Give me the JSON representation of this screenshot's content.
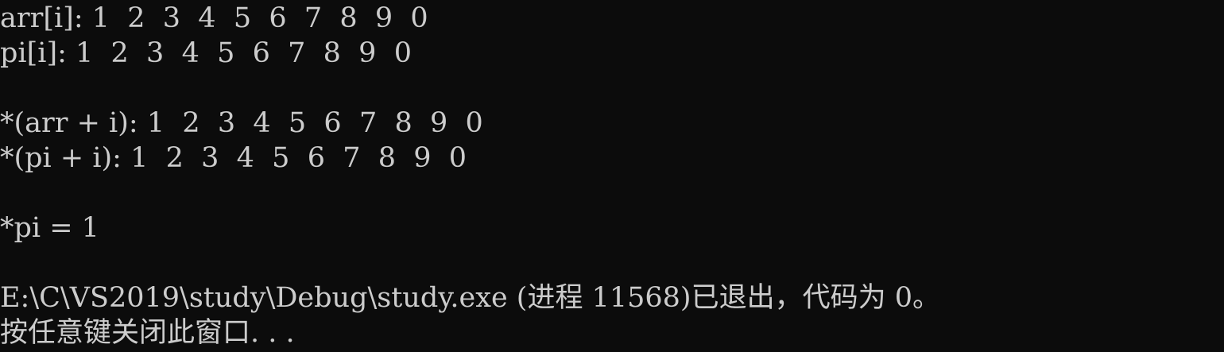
{
  "console": {
    "lines": [
      "arr[i]: 1  2  3  4  5  6  7  8  9  0",
      "pi[i]: 1  2  3  4  5  6  7  8  9  0",
      "",
      "*(arr + i): 1  2  3  4  5  6  7  8  9  0",
      "*(pi + i): 1  2  3  4  5  6  7  8  9  0",
      "",
      "*pi = 1",
      "",
      "E:\\C\\VS2019\\study\\Debug\\study.exe (进程 11568)已退出，代码为 0。",
      "按任意键关闭此窗口. . ."
    ]
  },
  "colors": {
    "background": "#0c0c0c",
    "foreground": "#cccccc"
  }
}
